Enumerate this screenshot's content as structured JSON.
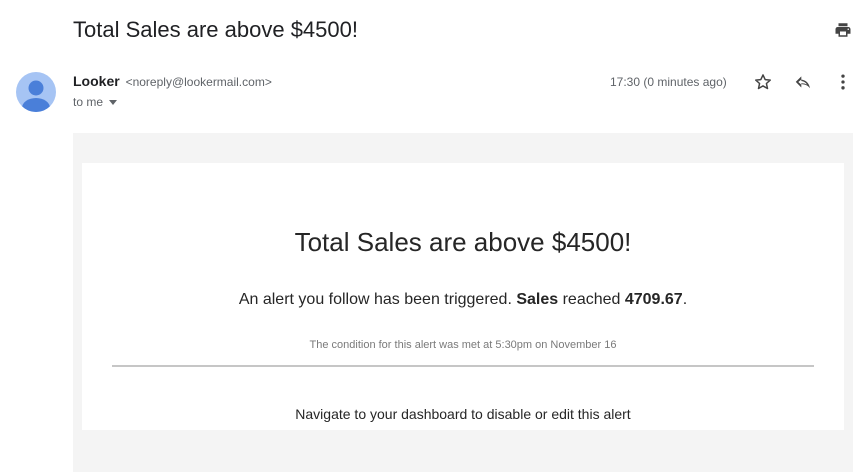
{
  "email": {
    "subject": "Total Sales are above $4500!",
    "sender_name": "Looker",
    "sender_email": "<noreply@lookermail.com>",
    "recipient": "to me",
    "timestamp": "17:30 (0 minutes ago)"
  },
  "icons": {
    "print": "print-icon",
    "star": "star-icon",
    "reply": "reply-icon",
    "more": "more-vert-icon",
    "avatar": "person-avatar-icon",
    "recipient_toggle": "caret-down-icon"
  },
  "colors": {
    "avatar_bg": "#a6c4f4",
    "avatar_fg": "#4a7fd9",
    "outer_bg": "#f4f4f4",
    "card_bg": "#ffffff"
  },
  "body": {
    "title": "Total Sales are above $4500!",
    "message_prefix": "An alert you follow has been triggered. ",
    "metric_name": "Sales",
    "message_middle": " reached ",
    "metric_value": "4709.67",
    "message_suffix": ".",
    "condition_text": "The condition for this alert was met at 5:30pm on November 16",
    "link_text": "Navigate to your dashboard to disable or edit this alert"
  }
}
